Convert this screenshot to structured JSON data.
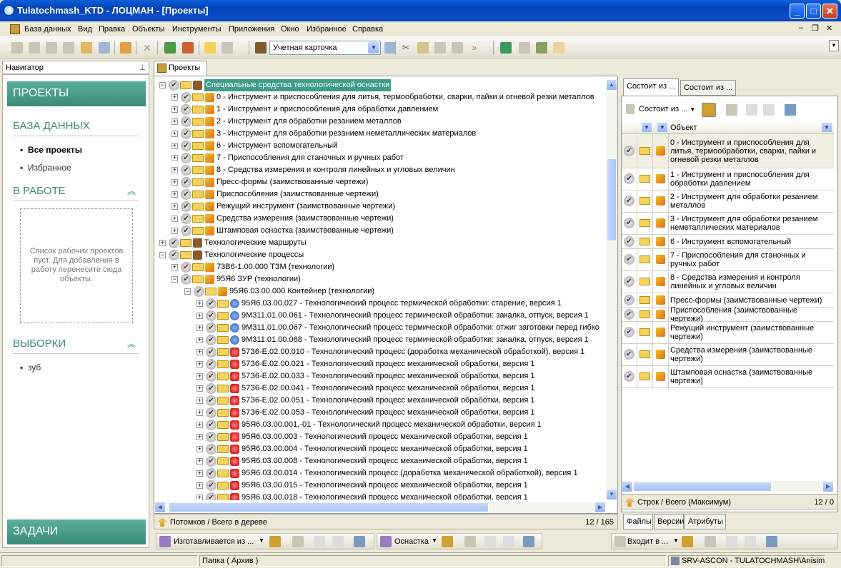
{
  "window": {
    "title": "Tulatochmash_KTD - ЛОЦМАН - [Проекты]"
  },
  "menu": [
    "База данных",
    "Вид",
    "Правка",
    "Объекты",
    "Инструменты",
    "Приложения",
    "Окно",
    "Избранное",
    "Справка"
  ],
  "toolbar": {
    "card_select": "Учетная карточка"
  },
  "navigator": {
    "title": "Навигатор",
    "projects_band": "ПРОЕКТЫ",
    "db_heading": "БАЗА ДАННЫХ",
    "db_items": [
      "Все проекты",
      "Избранное"
    ],
    "inwork_heading": "В РАБОТЕ",
    "inwork_empty": "Список рабочих проектов пуст. Для добавления в работу перенесите сюда объекты.",
    "selections_heading": "ВЫБОРКИ",
    "selection_items": [
      "зуб"
    ],
    "tasks_band": "ЗАДАЧИ"
  },
  "center": {
    "tab_label": "Проекты",
    "tree": [
      {
        "label": "Специальные средства технологической оснастки",
        "level": 0,
        "selected": true,
        "exp": "-",
        "obj": "box"
      },
      {
        "label": "0 - Инструмент и приспособления для литья, термообработки, сварки, пайки и огневой резки металлов",
        "level": 1,
        "exp": "+",
        "obj": "pen"
      },
      {
        "label": "1 - Инструмент и приспособления для обработки давлением",
        "level": 1,
        "exp": "+",
        "obj": "pen"
      },
      {
        "label": "2 - Инструмент для обработки резанием металлов",
        "level": 1,
        "exp": "+",
        "obj": "pen"
      },
      {
        "label": "3 - Инструмент для обработки резанием неметаллических материалов",
        "level": 1,
        "exp": "+",
        "obj": "pen"
      },
      {
        "label": "6 - Инструмент вспомогательный",
        "level": 1,
        "exp": "+",
        "obj": "pen"
      },
      {
        "label": "7 - Приспособления для станочных и ручных работ",
        "level": 1,
        "exp": "+",
        "obj": "pen"
      },
      {
        "label": "8 - Средства измерения и контроля линейных и угловых величин",
        "level": 1,
        "exp": "+",
        "obj": "pen"
      },
      {
        "label": "Пресс-формы (заимствованные чертежи)",
        "level": 1,
        "exp": "+",
        "obj": "pen"
      },
      {
        "label": "Приспособления (заимствованные чертежи)",
        "level": 1,
        "exp": "+",
        "obj": "pen"
      },
      {
        "label": "Режущий инструмент (заимствованные чертежи)",
        "level": 1,
        "exp": "+",
        "obj": "pen"
      },
      {
        "label": "Средства измерения (заимствованные чертежи)",
        "level": 1,
        "exp": "+",
        "obj": "pen"
      },
      {
        "label": "Штамповая оснастка (заимствованные чертежи)",
        "level": 1,
        "exp": "+",
        "obj": "pen"
      },
      {
        "label": "Технологические маршруты",
        "level": 0,
        "exp": "+",
        "obj": "box"
      },
      {
        "label": "Технологические процессы",
        "level": 0,
        "exp": "-",
        "obj": "box"
      },
      {
        "label": "73В6-1.00.000 ТЗМ (технологии)",
        "level": 1,
        "exp": "+",
        "obj": "pen",
        "red": true
      },
      {
        "label": "95Я6 ЗУР (технологии)",
        "level": 1,
        "exp": "-",
        "obj": "pen"
      },
      {
        "label": "95Я6.03.00.000 Контейнер (технологии)",
        "level": 2,
        "exp": "-",
        "obj": "pen"
      },
      {
        "label": "95Я6.03.00.027 - Технологический процесс термической обработки: старение, версия 1",
        "level": 3,
        "exp": "+",
        "obj": "gear"
      },
      {
        "label": "9М311.01.00.061 - Технологический процесс термической обработки: закалка, отпуск, версия 1",
        "level": 3,
        "exp": "+",
        "obj": "gear"
      },
      {
        "label": "9М311.01.00.067 - Технологический процесс термической обработки: отжиг заготовки перед гибко",
        "level": 3,
        "exp": "+",
        "obj": "gear"
      },
      {
        "label": "9М311.01.00.068 - Технологический процесс термической обработки: закалка, отпуск, версия 1",
        "level": 3,
        "exp": "+",
        "obj": "gear"
      },
      {
        "label": "57З6-Е.02.00.010 - Технологический процесс (доработка механической обработкой), версия 1",
        "level": 3,
        "exp": "+",
        "obj": "red"
      },
      {
        "label": "57З6-Е.02.00.021 - Технологический процесс механической обработки, версия 1",
        "level": 3,
        "exp": "+",
        "obj": "red"
      },
      {
        "label": "57З6-Е.02.00.033 - Технологический процесс механической обработки, версия 1",
        "level": 3,
        "exp": "+",
        "obj": "red"
      },
      {
        "label": "57З6-Е.02.00.041 - Технологический процесс механической обработки, версия 1",
        "level": 3,
        "exp": "+",
        "obj": "red"
      },
      {
        "label": "57З6-Е.02.00.051 - Технологический процесс механической обработки, версия 1",
        "level": 3,
        "exp": "+",
        "obj": "red"
      },
      {
        "label": "57З6-Е.02.00.053 - Технологический процесс механической обработки, версия 1",
        "level": 3,
        "exp": "+",
        "obj": "red"
      },
      {
        "label": "95Я6.03.00.001,-01 - Технологический процесс механической обработки, версия 1",
        "level": 3,
        "exp": "+",
        "obj": "red"
      },
      {
        "label": "95Я6.03.00.003 - Технологический процесс механической обработки, версия 1",
        "level": 3,
        "exp": "+",
        "obj": "red"
      },
      {
        "label": "95Я6.03.00.004 - Технологический процесс механической обработки, версия 1",
        "level": 3,
        "exp": "+",
        "obj": "red"
      },
      {
        "label": "95Я6.03.00.008 - Технологический процесс механической обработки, версия 1",
        "level": 3,
        "exp": "+",
        "obj": "red"
      },
      {
        "label": "95Я6.03.00.014 - Технологический процесс (доработка механической обработкой), версия 1",
        "level": 3,
        "exp": "+",
        "obj": "red"
      },
      {
        "label": "95Я6.03.00.015 - Технологический процесс механической обработки, версия 1",
        "level": 3,
        "exp": "+",
        "obj": "red"
      },
      {
        "label": "95Я6.03.00.018 - Технологический процесс механической обработки, версия 1",
        "level": 3,
        "exp": "+",
        "obj": "red"
      }
    ],
    "status_label": "Потомков / Всего в дереве",
    "status_count": "12 / 165"
  },
  "right": {
    "tabs": [
      "Состоит из ...",
      "Состоит из ..."
    ],
    "toolbar_label": "Состоит из",
    "column_object": "Объект",
    "rows": [
      {
        "text": "0 - Инструмент и приспособления для литья, термообработки, сварки, пайки и огневой резки металлов",
        "lines": 3,
        "selected": true
      },
      {
        "text": "1 - Инструмент и приспособления для обработки давлением",
        "lines": 2
      },
      {
        "text": "2 - Инструмент для обработки резанием металлов",
        "lines": 2
      },
      {
        "text": "3 - Инструмент для обработки резанием неметаллических материалов",
        "lines": 2
      },
      {
        "text": "6 - Инструмент вспомогательный",
        "lines": 1
      },
      {
        "text": "7 - Приспособления для станочных и ручных работ",
        "lines": 2
      },
      {
        "text": "8 - Средства измерения и контроля линейных и угловых величин",
        "lines": 2
      },
      {
        "text": "Пресс-формы (заимствованные чертежи)",
        "lines": 1
      },
      {
        "text": "Приспособления (заимствованные чертежи)",
        "lines": 1
      },
      {
        "text": "Режущий инструмент (заимствованные чертежи)",
        "lines": 2
      },
      {
        "text": "Средства измерения (заимствованные чертежи)",
        "lines": 2
      },
      {
        "text": "Штамповая оснастка (заимствованные чертежи)",
        "lines": 2
      }
    ],
    "status_label": "Строк / Всего (Максимум)",
    "status_count": "12 / 0",
    "bottom_tabs": [
      "Файлы",
      "Версии",
      "Атрибуты"
    ]
  },
  "bottom_toolbars": {
    "made_from": "Изготавливается из ...",
    "equipment": "Оснастка",
    "enters": "Входит в ..."
  },
  "statusbar": {
    "folder": "Папка ( Архив )",
    "server": "SRV-ASCON - TULATOCHMASH\\Anisimov"
  },
  "colors": {
    "accent": "#3a8c7b",
    "selection": "#3d9c8c",
    "titlebar": "#0441b8"
  }
}
